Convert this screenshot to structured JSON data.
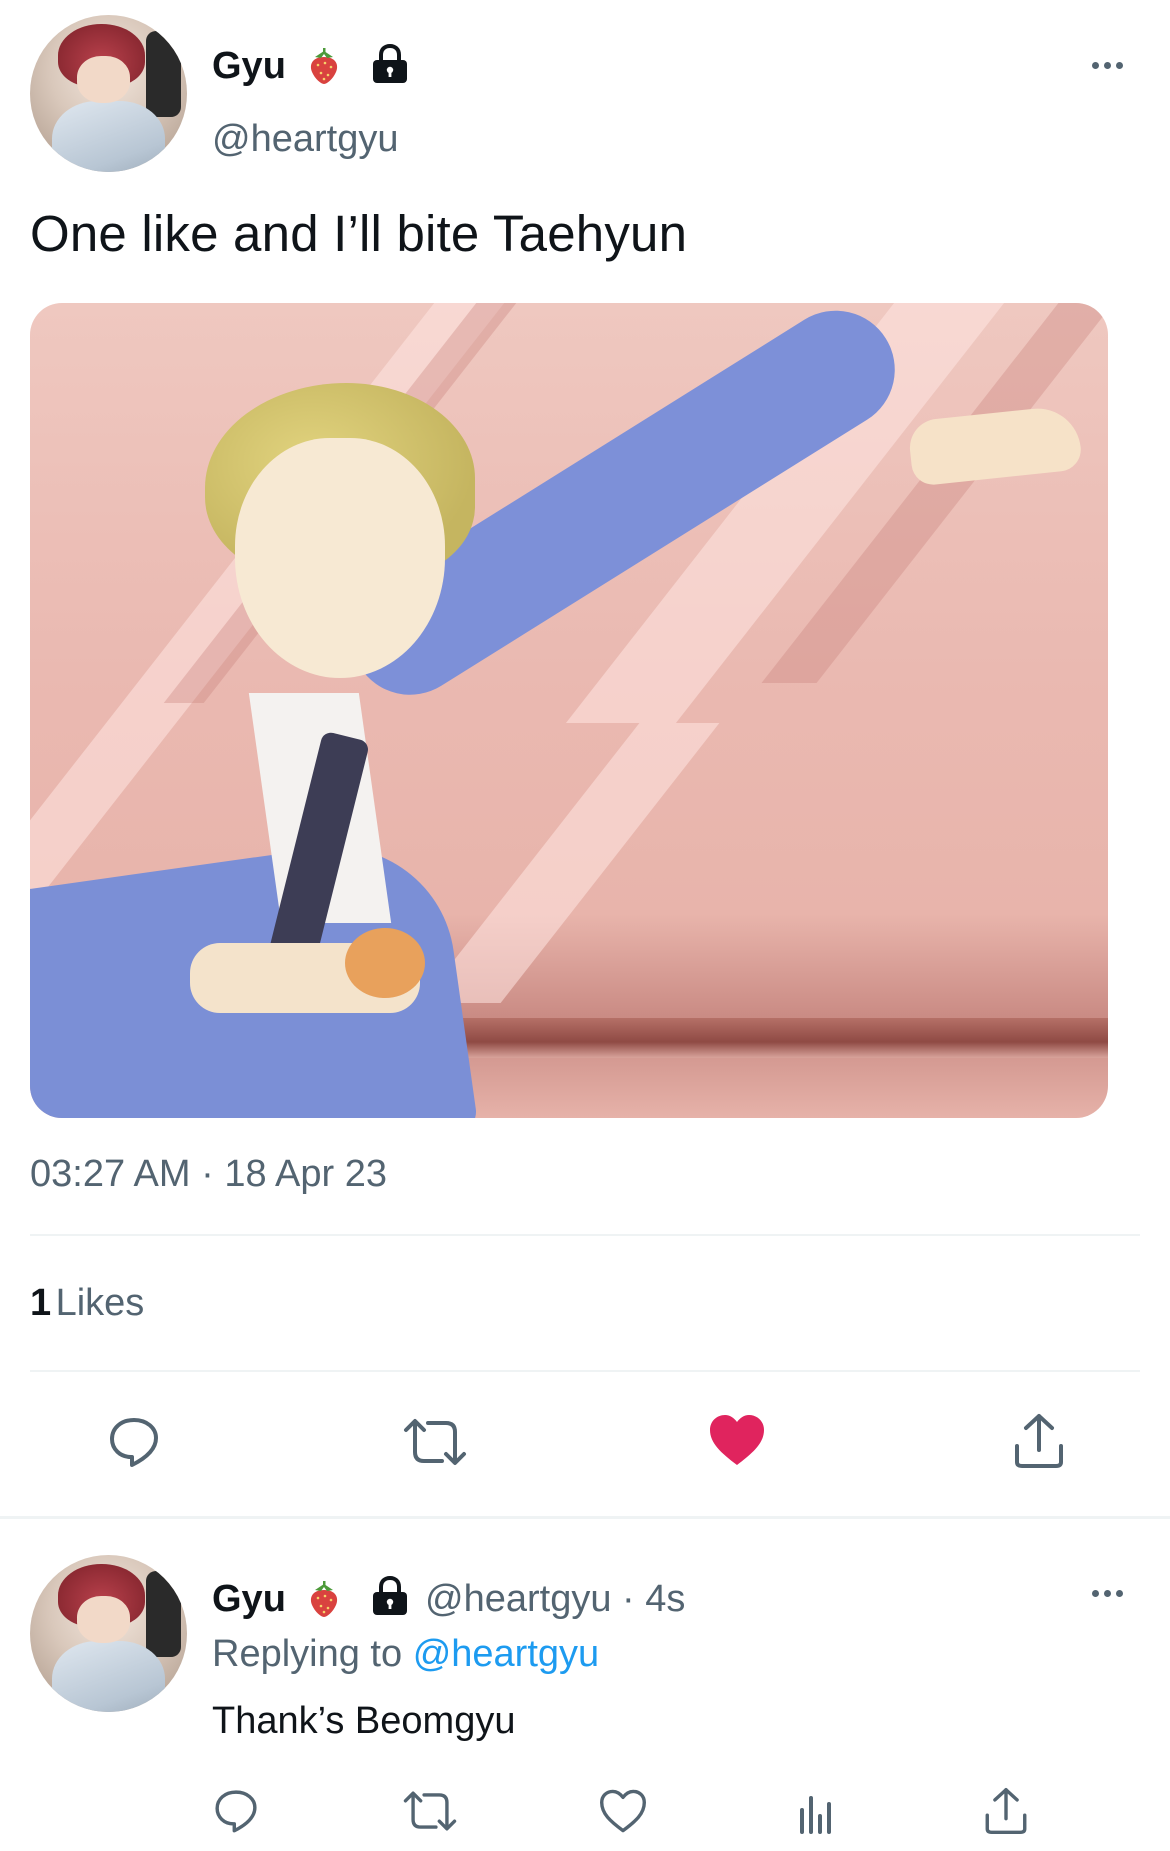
{
  "tweet": {
    "author": {
      "display_name": "Gyu",
      "handle": "@heartgyu",
      "emoji": "strawberry-icon",
      "locked": "lock-icon"
    },
    "text": "One like and I’ll bite Taehyun",
    "media": "anime-character-image",
    "timestamp": "03:27 AM · 18 Apr 23",
    "stats": {
      "likes_count": "1",
      "likes_label": "Likes"
    },
    "actions": [
      "reply-icon",
      "retweet-icon",
      "like-icon-filled",
      "share-icon"
    ],
    "colors": {
      "like_active": "#e0245e",
      "icon_gray": "#536471",
      "link_blue": "#1d9bf0"
    }
  },
  "reply": {
    "author": {
      "display_name": "Gyu",
      "handle": "@heartgyu",
      "separator": "·",
      "age": "4s"
    },
    "replying_prefix": "Replying to",
    "replying_to": "@heartgyu",
    "text": "Thank’s Beomgyu",
    "actions": [
      "reply-icon",
      "retweet-icon",
      "like-icon",
      "views-icon",
      "share-icon"
    ]
  }
}
